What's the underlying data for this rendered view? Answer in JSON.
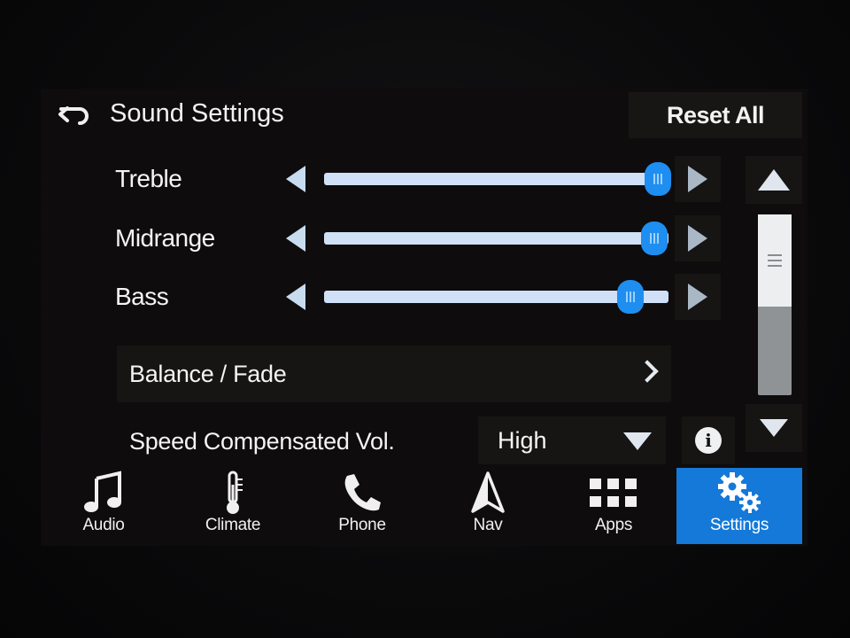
{
  "header": {
    "title": "Sound Settings",
    "back_icon": "back-arrow-icon",
    "reset_label": "Reset All"
  },
  "sliders": [
    {
      "label": "Treble",
      "level": 0.97
    },
    {
      "label": "Midrange",
      "level": 0.96
    },
    {
      "label": "Bass",
      "level": 0.89
    }
  ],
  "balance": {
    "label": "Balance / Fade",
    "icon": "chevron-right-icon"
  },
  "speed_comp": {
    "label": "Speed Compensated Vol.",
    "value": "High",
    "info_symbol": "i"
  },
  "scrollbar": {
    "position": 0.0
  },
  "nav": {
    "items": [
      {
        "label": "Audio",
        "icon": "music-note-icon",
        "active": false
      },
      {
        "label": "Climate",
        "icon": "thermometer-icon",
        "active": false
      },
      {
        "label": "Phone",
        "icon": "phone-icon",
        "active": false
      },
      {
        "label": "Nav",
        "icon": "navigation-arrow-icon",
        "active": false
      },
      {
        "label": "Apps",
        "icon": "apps-grid-icon",
        "active": false
      },
      {
        "label": "Settings",
        "icon": "gears-icon",
        "active": true
      }
    ]
  },
  "colors": {
    "accent": "#1479d9",
    "thumb": "#1e8ef0",
    "track": "#cfe0f7"
  }
}
